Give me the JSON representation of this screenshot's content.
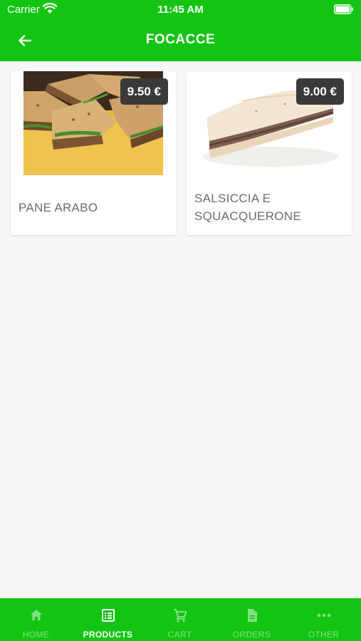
{
  "status_bar": {
    "carrier": "Carrier",
    "time": "11:45 AM"
  },
  "header": {
    "title": "FOCACCE",
    "back_icon": "arrow-left-icon"
  },
  "products": [
    {
      "name": "PANE ARABO",
      "price": "9.50 €"
    },
    {
      "name": "SALSICCIA E SQUACQUERONE",
      "price": "9.00 €"
    }
  ],
  "tabs": [
    {
      "label": "HOME",
      "icon": "home-icon",
      "active": false
    },
    {
      "label": "PRODUCTS",
      "icon": "list-icon",
      "active": true
    },
    {
      "label": "CART",
      "icon": "cart-icon",
      "active": false
    },
    {
      "label": "ORDERS",
      "icon": "document-icon",
      "active": false
    },
    {
      "label": "OTHER",
      "icon": "more-icon",
      "active": false
    }
  ],
  "colors": {
    "brand_green": "#13c413",
    "tab_inactive": "#82e382",
    "price_badge": "#3a3a3a"
  }
}
